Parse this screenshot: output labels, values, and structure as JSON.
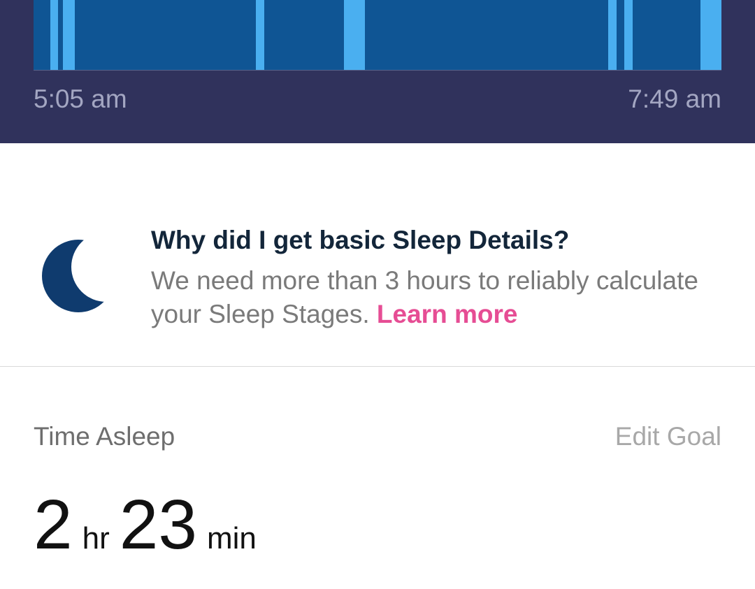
{
  "header": {
    "start_time": "5:05 am",
    "end_time": "7:49 am",
    "colors": {
      "background": "#30325c",
      "asleep": "#0f5594",
      "awake": "#4aaff0"
    }
  },
  "info": {
    "icon": "moon-icon",
    "title": "Why did I get basic Sleep Details?",
    "body": "We need more than 3 hours to reliably calculate your Sleep Stages. ",
    "link": "Learn more",
    "link_color": "#e64d94"
  },
  "summary": {
    "label": "Time Asleep",
    "edit_goal": "Edit Goal",
    "hours": "2",
    "hours_unit": "hr",
    "minutes": "23",
    "minutes_unit": "min"
  }
}
